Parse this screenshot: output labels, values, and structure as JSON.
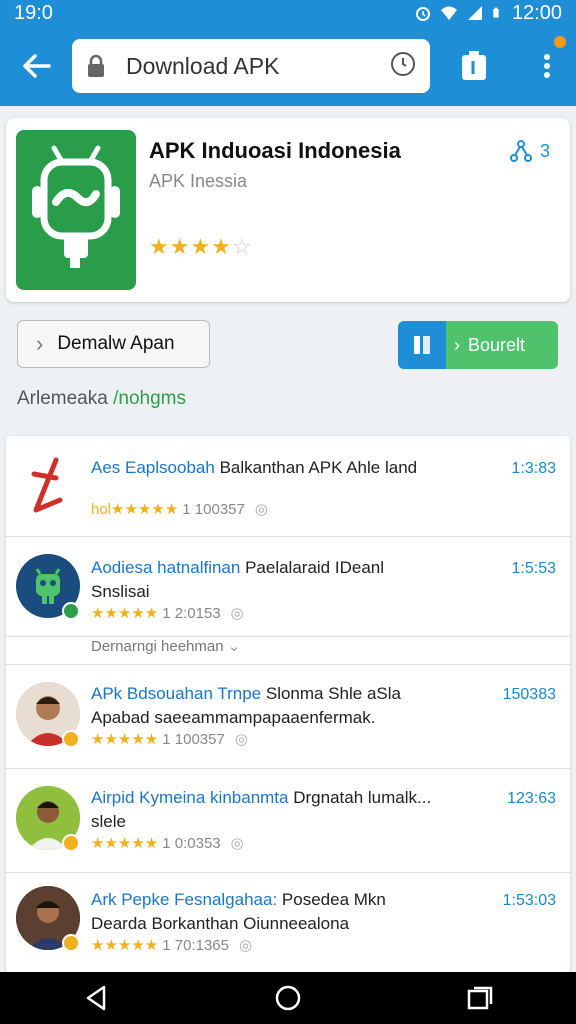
{
  "status_bar": {
    "time_left": "19:0",
    "time_right": "12:00",
    "icons": [
      "alarm-icon",
      "wifi-icon",
      "signal-icon",
      "battery-icon"
    ]
  },
  "appbar": {
    "url": "Download APK",
    "icons": [
      "back-arrow-icon",
      "lock-icon",
      "info-icon",
      "tab-icon",
      "more-vert-icon"
    ]
  },
  "app": {
    "title": "APK Induoasi Indonesia",
    "subtitle": "APK Inessia",
    "rating_stars": 4,
    "rating_max": 5,
    "share_count": "3"
  },
  "actions": {
    "details_label": "Demalw Apan",
    "download_label": "Bourelt"
  },
  "section": {
    "label": "Arlemeaka",
    "link": "/nohgms"
  },
  "list": {
    "subheader": "Dernarngi heehman",
    "items": [
      {
        "title": "Aes Eaplsoobah",
        "title_rest": "Balkanthan APK Ahle land",
        "subtitle": "",
        "rating_prefix": "hol",
        "stars": "★★★★★",
        "count": "1 100357",
        "size": "1:3:83",
        "avatar": "arrow-logo"
      },
      {
        "title": "Aodiesa hatnalfinan",
        "title_rest": "Paelalaraid IDeanl",
        "subtitle": "Snslisai",
        "rating_prefix": "",
        "stars": "★★★★★",
        "count": "1 2:0153",
        "size": "1:5:53",
        "avatar": "android-logo"
      },
      {
        "title": "APk Bdsouahan Trnpe",
        "title_rest": "Slonma Shle aSla",
        "subtitle": "Apabad saeeammampapaaenfermak.",
        "rating_prefix": "",
        "stars": "★★★★★",
        "count": "1 100357",
        "size": "150383",
        "avatar": "person-1"
      },
      {
        "title": "Airpid Kymeina kinbanmta",
        "title_rest": "Drgnatah lumalk...",
        "subtitle": "slele",
        "rating_prefix": "",
        "stars": "★★★★★",
        "count": "1 0:0353",
        "size": "123:63",
        "avatar": "person-2"
      },
      {
        "title": "Ark Pepke Fesnalgahaa:",
        "title_rest": "Posedea Mkn",
        "subtitle": "Dearda Borkanthan Oiunneealona",
        "rating_prefix": "",
        "stars": "★★★★★",
        "count": "1 70:1365",
        "size": "1:53:03",
        "avatar": "person-3"
      }
    ]
  },
  "nav": {
    "icons": [
      "back-triangle-icon",
      "home-circle-icon",
      "recents-square-icon"
    ]
  },
  "colors": {
    "primary": "#1e8fd6",
    "accent_green": "#4fc36b",
    "app_icon_green": "#2a9d4a",
    "star": "#f2b01e"
  }
}
